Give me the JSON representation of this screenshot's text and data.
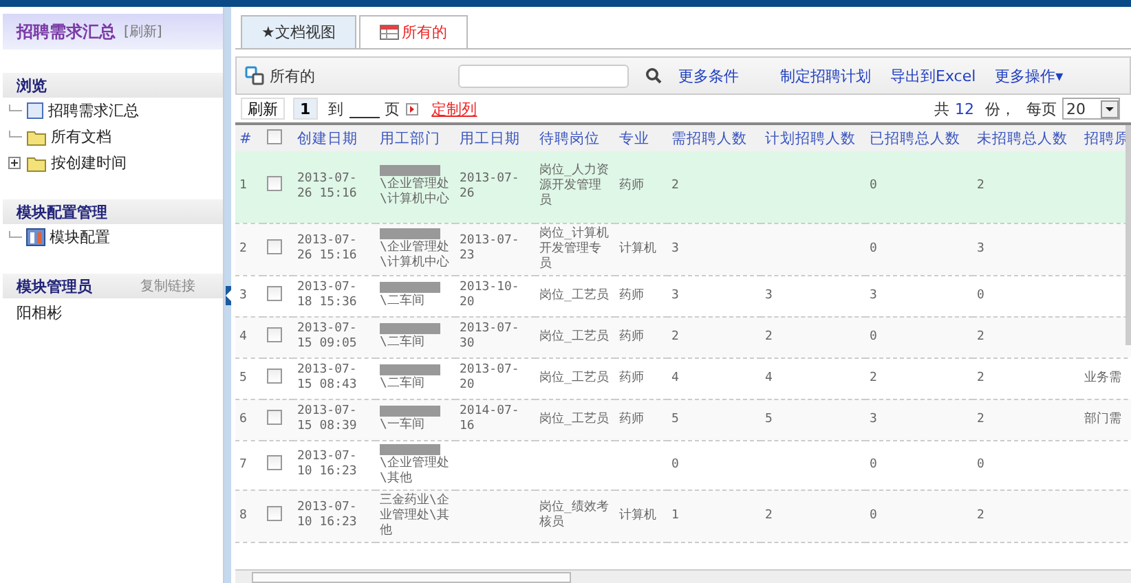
{
  "sidebar": {
    "title": "招聘需求汇总",
    "refresh": "[刷新]",
    "sections": [
      {
        "title": "浏览",
        "items": [
          {
            "label": "招聘需求汇总",
            "kind": "page",
            "expander": false
          },
          {
            "label": "所有文档",
            "kind": "folder",
            "expander": false
          },
          {
            "label": "按创建时间",
            "kind": "folder",
            "expander": true
          }
        ]
      },
      {
        "title": "模块配置管理",
        "items": [
          {
            "label": "模块配置",
            "kind": "config",
            "expander": false
          }
        ]
      }
    ],
    "admin": {
      "title": "模块管理员",
      "action": "复制链接",
      "user": "阳相彬"
    }
  },
  "tabs": [
    {
      "label": "★文档视图",
      "selected": true
    },
    {
      "label": "所有的",
      "selected": false
    }
  ],
  "toolbar": {
    "view": "所有的",
    "links": [
      "更多条件",
      "制定招聘计划",
      "导出到Excel"
    ],
    "menu": "更多操作",
    "menu_caret": "▾"
  },
  "pager": {
    "refresh": "刷新",
    "page": "1",
    "to": "到",
    "page_unit": "页",
    "custom": "定制列",
    "total_prefix": "共",
    "total": "12",
    "total_suffix": "份，",
    "per_page": "每页",
    "per_page_value": "20"
  },
  "table": {
    "all_checked": false,
    "columns": [
      "#",
      "创建日期",
      "用工部门",
      "用工日期",
      "待聘岗位",
      "专业",
      "需招聘人数",
      "计划招聘人数",
      "已招聘总人数",
      "未招聘总人数",
      "招聘原"
    ],
    "rows": [
      {
        "no": "1",
        "checked": false,
        "selected": true,
        "redacted": true,
        "created": "2013-07-26 15:16",
        "dept": "\\企业管理处\\计算机中心",
        "date": "2013-07-26",
        "post": "岗位_人力资源开发管理员",
        "major": "药师",
        "need": "2",
        "plan": "",
        "hired": "0",
        "unhired": "2",
        "reason": ""
      },
      {
        "no": "2",
        "checked": false,
        "selected": false,
        "redacted": true,
        "created": "2013-07-26 15:16",
        "dept": "\\企业管理处\\计算机中心",
        "date": "2013-07-23",
        "post": "岗位_计算机开发管理专员",
        "major": "计算机",
        "need": "3",
        "plan": "",
        "hired": "0",
        "unhired": "3",
        "reason": ""
      },
      {
        "no": "3",
        "checked": false,
        "selected": false,
        "redacted": true,
        "created": "2013-07-18 15:36",
        "dept": "\\二车间",
        "date": "2013-10-20",
        "post": "岗位_工艺员",
        "major": "药师",
        "need": "3",
        "plan": "3",
        "hired": "3",
        "unhired": "0",
        "reason": ""
      },
      {
        "no": "4",
        "checked": false,
        "selected": false,
        "redacted": true,
        "created": "2013-07-15 09:05",
        "dept": "\\二车间",
        "date": "2013-07-30",
        "post": "岗位_工艺员",
        "major": "药师",
        "need": "2",
        "plan": "2",
        "hired": "0",
        "unhired": "2",
        "reason": ""
      },
      {
        "no": "5",
        "checked": false,
        "selected": false,
        "redacted": true,
        "created": "2013-07-15 08:43",
        "dept": "\\二车间",
        "date": "2013-07-20",
        "post": "岗位_工艺员",
        "major": "药师",
        "need": "4",
        "plan": "4",
        "hired": "2",
        "unhired": "2",
        "reason": "业务需"
      },
      {
        "no": "6",
        "checked": false,
        "selected": false,
        "redacted": true,
        "created": "2013-07-15 08:39",
        "dept": "\\一车间",
        "date": "2014-07-16",
        "post": "岗位_工艺员",
        "major": "药师",
        "need": "5",
        "plan": "5",
        "hired": "3",
        "unhired": "2",
        "reason": "部门需"
      },
      {
        "no": "7",
        "checked": false,
        "selected": false,
        "redacted": true,
        "created": "2013-07-10 16:23",
        "dept": "\\企业管理处\\其他",
        "date": "",
        "post": "",
        "major": "",
        "need": "0",
        "plan": "",
        "hired": "0",
        "unhired": "0",
        "reason": ""
      },
      {
        "no": "8",
        "checked": false,
        "selected": false,
        "redacted": false,
        "created": "2013-07-10 16:23",
        "dept": "三金药业\\企业管理处\\其他",
        "date": "",
        "post": "岗位_绩效考核员",
        "major": "计算机",
        "need": "1",
        "plan": "2",
        "hired": "0",
        "unhired": "2",
        "reason": ""
      }
    ]
  }
}
